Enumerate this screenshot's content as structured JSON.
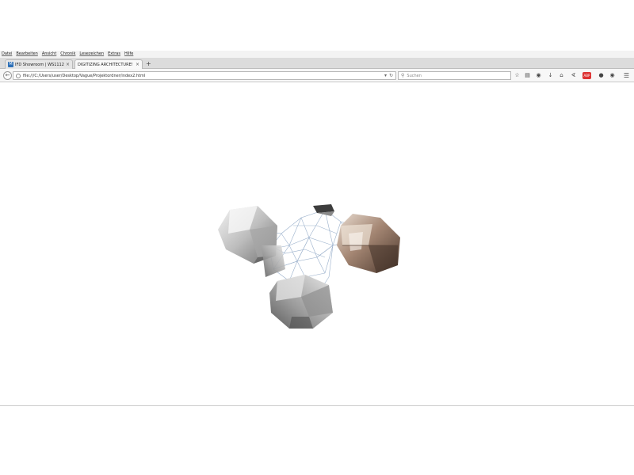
{
  "menubar": {
    "items": [
      "Datei",
      "Bearbeiten",
      "Ansicht",
      "Chronik",
      "Lesezeichen",
      "Extras",
      "Hilfe"
    ]
  },
  "tabs": [
    {
      "favicon": "M",
      "title": "IFD Showroom | WS1112 | Wie ...",
      "active": false
    },
    {
      "favicon": "",
      "title": "DIGITIZING ARCHITECTURE!",
      "active": true
    }
  ],
  "navbar": {
    "url": "file:///C:/Users/user/Desktop/Vague/Projektordner/index2.html",
    "search_placeholder": "Suchen"
  },
  "icons": {
    "back": "back-arrow-icon",
    "bookmark": "star-icon",
    "clipboard": "clipboard-icon",
    "pocket": "pocket-icon",
    "download": "download-icon",
    "home": "home-icon",
    "adblock": "adblock-icon",
    "extension": "extension-icon",
    "menu": "hamburger-menu-icon"
  },
  "colors": {
    "wireframe": "#9bb1cc",
    "tab_active": "#f9f9f9",
    "adblock": "#dd3333"
  }
}
